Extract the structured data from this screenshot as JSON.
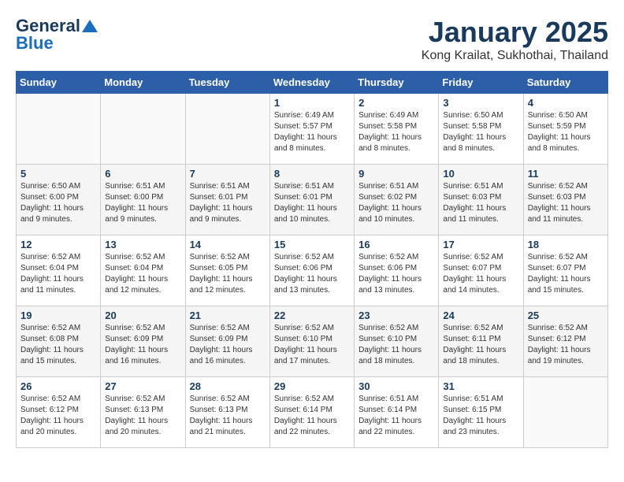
{
  "header": {
    "logo_line1": "General",
    "logo_line2": "Blue",
    "month": "January 2025",
    "location": "Kong Krailat, Sukhothai, Thailand"
  },
  "weekdays": [
    "Sunday",
    "Monday",
    "Tuesday",
    "Wednesday",
    "Thursday",
    "Friday",
    "Saturday"
  ],
  "weeks": [
    [
      {
        "day": "",
        "info": ""
      },
      {
        "day": "",
        "info": ""
      },
      {
        "day": "",
        "info": ""
      },
      {
        "day": "1",
        "info": "Sunrise: 6:49 AM\nSunset: 5:57 PM\nDaylight: 11 hours and 8 minutes."
      },
      {
        "day": "2",
        "info": "Sunrise: 6:49 AM\nSunset: 5:58 PM\nDaylight: 11 hours and 8 minutes."
      },
      {
        "day": "3",
        "info": "Sunrise: 6:50 AM\nSunset: 5:58 PM\nDaylight: 11 hours and 8 minutes."
      },
      {
        "day": "4",
        "info": "Sunrise: 6:50 AM\nSunset: 5:59 PM\nDaylight: 11 hours and 8 minutes."
      }
    ],
    [
      {
        "day": "5",
        "info": "Sunrise: 6:50 AM\nSunset: 6:00 PM\nDaylight: 11 hours and 9 minutes."
      },
      {
        "day": "6",
        "info": "Sunrise: 6:51 AM\nSunset: 6:00 PM\nDaylight: 11 hours and 9 minutes."
      },
      {
        "day": "7",
        "info": "Sunrise: 6:51 AM\nSunset: 6:01 PM\nDaylight: 11 hours and 9 minutes."
      },
      {
        "day": "8",
        "info": "Sunrise: 6:51 AM\nSunset: 6:01 PM\nDaylight: 11 hours and 10 minutes."
      },
      {
        "day": "9",
        "info": "Sunrise: 6:51 AM\nSunset: 6:02 PM\nDaylight: 11 hours and 10 minutes."
      },
      {
        "day": "10",
        "info": "Sunrise: 6:51 AM\nSunset: 6:03 PM\nDaylight: 11 hours and 11 minutes."
      },
      {
        "day": "11",
        "info": "Sunrise: 6:52 AM\nSunset: 6:03 PM\nDaylight: 11 hours and 11 minutes."
      }
    ],
    [
      {
        "day": "12",
        "info": "Sunrise: 6:52 AM\nSunset: 6:04 PM\nDaylight: 11 hours and 11 minutes."
      },
      {
        "day": "13",
        "info": "Sunrise: 6:52 AM\nSunset: 6:04 PM\nDaylight: 11 hours and 12 minutes."
      },
      {
        "day": "14",
        "info": "Sunrise: 6:52 AM\nSunset: 6:05 PM\nDaylight: 11 hours and 12 minutes."
      },
      {
        "day": "15",
        "info": "Sunrise: 6:52 AM\nSunset: 6:06 PM\nDaylight: 11 hours and 13 minutes."
      },
      {
        "day": "16",
        "info": "Sunrise: 6:52 AM\nSunset: 6:06 PM\nDaylight: 11 hours and 13 minutes."
      },
      {
        "day": "17",
        "info": "Sunrise: 6:52 AM\nSunset: 6:07 PM\nDaylight: 11 hours and 14 minutes."
      },
      {
        "day": "18",
        "info": "Sunrise: 6:52 AM\nSunset: 6:07 PM\nDaylight: 11 hours and 15 minutes."
      }
    ],
    [
      {
        "day": "19",
        "info": "Sunrise: 6:52 AM\nSunset: 6:08 PM\nDaylight: 11 hours and 15 minutes."
      },
      {
        "day": "20",
        "info": "Sunrise: 6:52 AM\nSunset: 6:09 PM\nDaylight: 11 hours and 16 minutes."
      },
      {
        "day": "21",
        "info": "Sunrise: 6:52 AM\nSunset: 6:09 PM\nDaylight: 11 hours and 16 minutes."
      },
      {
        "day": "22",
        "info": "Sunrise: 6:52 AM\nSunset: 6:10 PM\nDaylight: 11 hours and 17 minutes."
      },
      {
        "day": "23",
        "info": "Sunrise: 6:52 AM\nSunset: 6:10 PM\nDaylight: 11 hours and 18 minutes."
      },
      {
        "day": "24",
        "info": "Sunrise: 6:52 AM\nSunset: 6:11 PM\nDaylight: 11 hours and 18 minutes."
      },
      {
        "day": "25",
        "info": "Sunrise: 6:52 AM\nSunset: 6:12 PM\nDaylight: 11 hours and 19 minutes."
      }
    ],
    [
      {
        "day": "26",
        "info": "Sunrise: 6:52 AM\nSunset: 6:12 PM\nDaylight: 11 hours and 20 minutes."
      },
      {
        "day": "27",
        "info": "Sunrise: 6:52 AM\nSunset: 6:13 PM\nDaylight: 11 hours and 20 minutes."
      },
      {
        "day": "28",
        "info": "Sunrise: 6:52 AM\nSunset: 6:13 PM\nDaylight: 11 hours and 21 minutes."
      },
      {
        "day": "29",
        "info": "Sunrise: 6:52 AM\nSunset: 6:14 PM\nDaylight: 11 hours and 22 minutes."
      },
      {
        "day": "30",
        "info": "Sunrise: 6:51 AM\nSunset: 6:14 PM\nDaylight: 11 hours and 22 minutes."
      },
      {
        "day": "31",
        "info": "Sunrise: 6:51 AM\nSunset: 6:15 PM\nDaylight: 11 hours and 23 minutes."
      },
      {
        "day": "",
        "info": ""
      }
    ]
  ]
}
